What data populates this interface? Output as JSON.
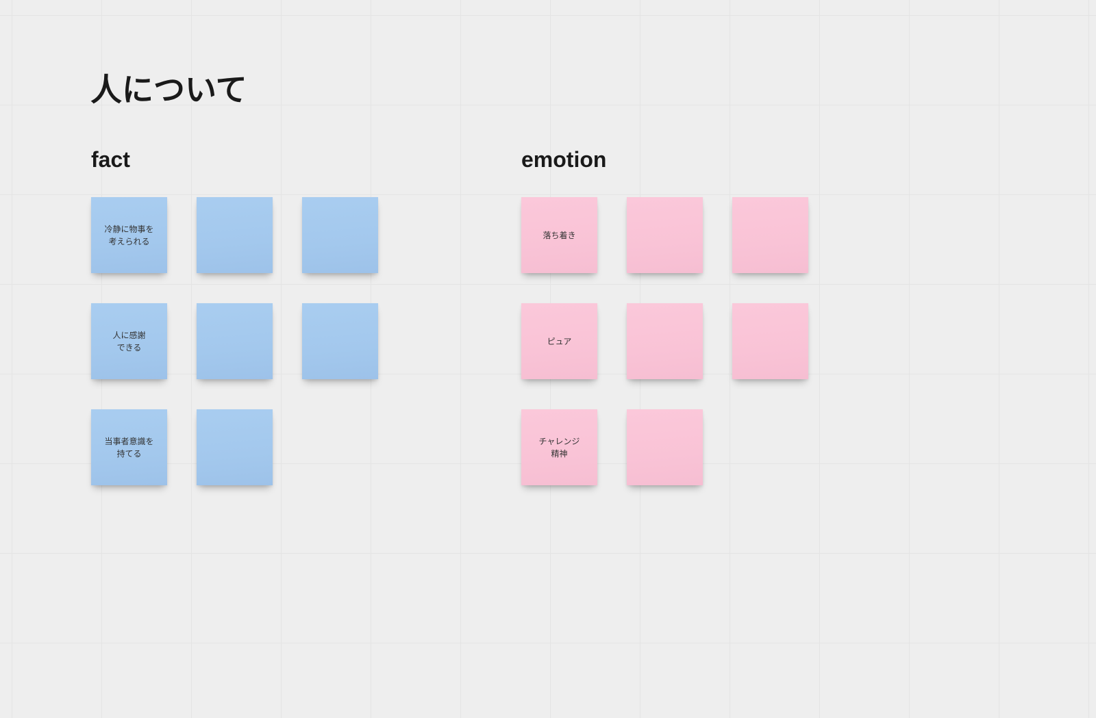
{
  "title": "人について",
  "sections": {
    "fact": {
      "heading": "fact",
      "color": "blue",
      "notes": [
        [
          "冷静に物事を\n考えられる",
          "",
          ""
        ],
        [
          "人に感謝\nできる",
          "",
          ""
        ],
        [
          "当事者意識を\n持てる",
          ""
        ]
      ]
    },
    "emotion": {
      "heading": "emotion",
      "color": "pink",
      "notes": [
        [
          "落ち着き",
          "",
          ""
        ],
        [
          "ピュア",
          "",
          ""
        ],
        [
          "チャレンジ\n精神",
          ""
        ]
      ]
    }
  },
  "colors": {
    "blue": "#a3c8ed",
    "pink": "#f9c3d6",
    "background": "#eeeeee",
    "grid": "#e6e6e6"
  }
}
